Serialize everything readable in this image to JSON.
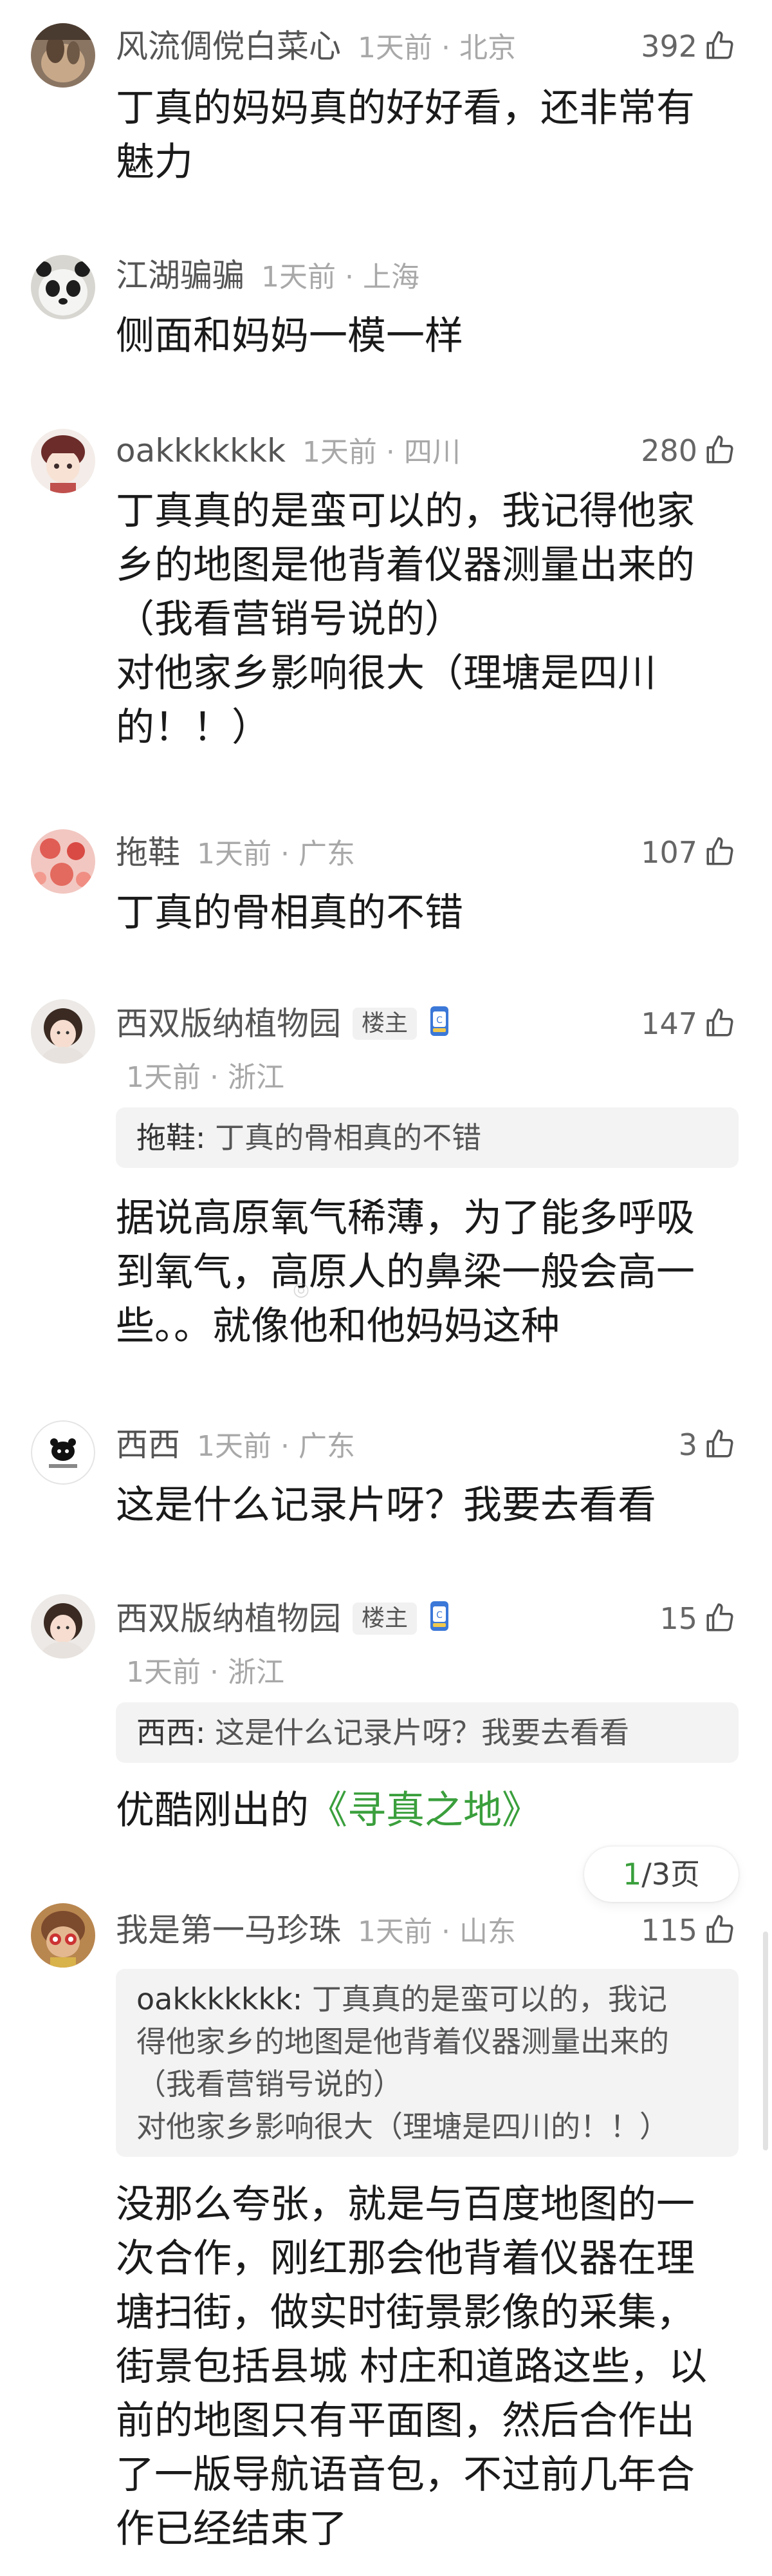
{
  "comments": [
    {
      "username": "风流倜傥白菜心",
      "time": "1天前 · 北京",
      "likes": "392",
      "text": "丁真的妈妈真的好好看，还非常有\n魅力"
    },
    {
      "username": "江湖骗骗",
      "time": "1天前 · 上海",
      "likes": "",
      "text": "侧面和妈妈一模一样"
    },
    {
      "username": "oakkkkkkk",
      "time": "1天前 · 四川",
      "likes": "280",
      "text": "丁真真的是蛮可以的，我记得他家\n乡的地图是他背着仪器测量出来的\n（我看营销号说的）\n对他家乡影响很大（理塘是四川\n的！！）"
    },
    {
      "username": "拖鞋",
      "time": "1天前 · 广东",
      "likes": "107",
      "text": "丁真的骨相真的不错"
    },
    {
      "username": "西双版纳植物园",
      "op_badge": "楼主",
      "time": "1天前 · 浙江",
      "likes": "147",
      "quote_author": "拖鞋:",
      "quote_text": " 丁真的骨相真的不错",
      "text": "据说高原氧气稀薄，为了能多呼吸\n到氧气，高原人的鼻梁一般会高一\n些。。就像他和他妈妈这种"
    },
    {
      "username": "西西",
      "time": "1天前 · 广东",
      "likes": "3",
      "text": "这是什么记录片呀？我要去看看"
    },
    {
      "username": "西双版纳植物园",
      "op_badge": "楼主",
      "time": "1天前 · 浙江",
      "likes": "15",
      "quote_author": "西西:",
      "quote_text": " 这是什么记录片呀？我要去看看",
      "text_prefix": "优酷刚出的",
      "link_text": "《寻真之地》"
    },
    {
      "username": "我是第一马珍珠",
      "time": "1天前 · 山东",
      "likes": "115",
      "quote_author": "oakkkkkkk:",
      "quote_text": " 丁真真的是蛮可以的，我记\n得他家乡的地图是他背着仪器测量出来的\n（我看营销号说的）\n对他家乡影响很大（理塘是四川的！！）",
      "text": "没那么夸张，就是与百度地图的一\n次合作，刚红那会他背着仪器在理\n塘扫街，做实时街景影像的采集，\n街景包括县城 村庄和道路这些，以\n前的地图只有平面图，然后合作出\n了一版导航语音包，不过前几年合\n作已经结束了"
    }
  ],
  "pager": {
    "current": "1",
    "rest": "/3页"
  },
  "icons": {
    "like": "thumbs-up-icon",
    "medal": "badge-medal-icon"
  },
  "colors": {
    "accent": "#3a9f3c",
    "username": "#555555",
    "meta": "#a8a8a8"
  }
}
